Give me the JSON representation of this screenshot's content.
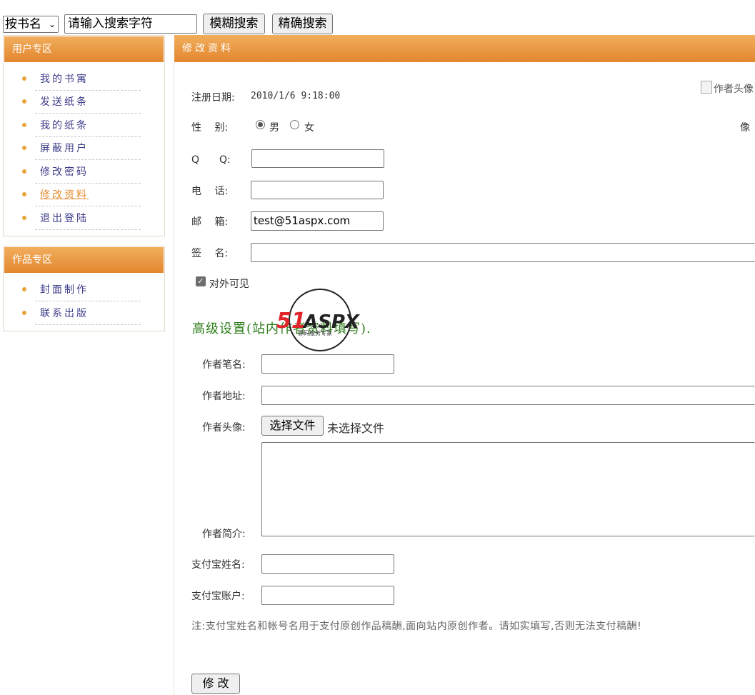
{
  "search": {
    "mode_selected": "按书名",
    "input_value": "请输入搜索字符",
    "fuzzy_button": "模糊搜索",
    "exact_button": "精确搜索"
  },
  "sidebar": {
    "user_section_title": "用户专区",
    "user_items": [
      "我的书寓",
      "发送纸条",
      "我的纸条",
      "屏蔽用户",
      "修改密码",
      "修改资料",
      "退出登陆"
    ],
    "works_section_title": "作品专区",
    "works_items": [
      "封面制作",
      "联系出版"
    ]
  },
  "main": {
    "title": "修改资料",
    "register_label": "注册日期:",
    "register_value": "2010/1/6 9:18:00",
    "avatar_alt": "作者头像",
    "avatar_caption": "像",
    "gender_label": "性　 别:",
    "gender_male": "男",
    "gender_female": "女",
    "qq_label": "Q　　Q:",
    "qq_value": "",
    "phone_label": "电　 话:",
    "phone_value": "",
    "email_label": "邮　 箱:",
    "email_value": "test@51aspx.com",
    "signature_label": "签　 名:",
    "signature_value": "",
    "public_checkbox_label": "对外可见",
    "advanced_title": "高级设置(站内作者资料填写).",
    "pen_name_label": "作者笔名:",
    "pen_name_value": "",
    "address_label": "作者地址:",
    "address_value": "",
    "avatar_label": "作者头像:",
    "file_button": "选择文件",
    "file_status": "未选择文件",
    "intro_label": "作者简介:",
    "intro_value": "",
    "alipay_name_label": "支付宝姓名:",
    "alipay_name_value": "",
    "alipay_account_label": "支付宝账户:",
    "alipay_account_value": "",
    "note": "注:支付宝姓名和帐号名用于支付原创作品稿酬,面向站内原创作者。请如实填写,否则无法支付稿酬!",
    "submit_button": "修 改"
  },
  "watermark": {
    "logo_text": "51ASPX",
    "sub_text": "源码服务专家"
  },
  "colors": {
    "header_orange": "#e3862f",
    "nav_link": "#3d3d8a",
    "active_link": "#e38d2f",
    "advanced_title": "#2e7d1a"
  }
}
